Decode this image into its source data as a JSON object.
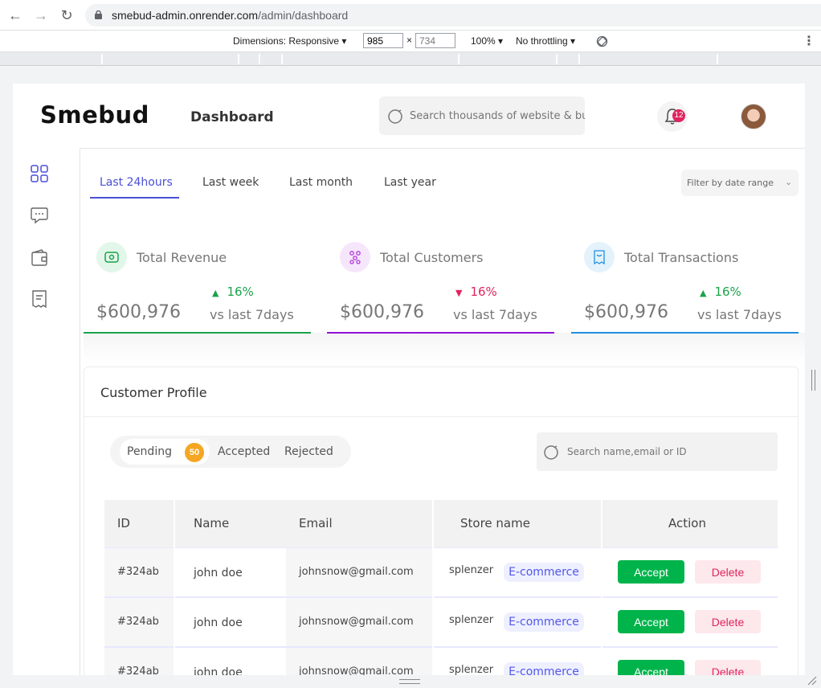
{
  "browser": {
    "url_host": "smebud-admin.onrender.com",
    "url_path": "/admin/dashboard",
    "device_dimensions": "Dimensions: Responsive",
    "width_value": "985",
    "height_value": "734",
    "zoom": "100%",
    "throttling": "No throttling"
  },
  "header": {
    "logo": "Smebud",
    "title": "Dashboard",
    "search_placeholder": "Search thousands of website & bussiness",
    "notification_count": "12"
  },
  "tabs": [
    {
      "label": "Last 24hours",
      "active": true
    },
    {
      "label": "Last week",
      "active": false
    },
    {
      "label": "Last month",
      "active": false
    },
    {
      "label": "Last year",
      "active": false
    }
  ],
  "filter": {
    "label": "Filter by date range"
  },
  "stats": [
    {
      "title": "Total Revenue",
      "trend": "16%",
      "direction": "up",
      "amount": "$600,976",
      "compare": "vs last 7days",
      "color": "#1aa34a"
    },
    {
      "title": "Total Customers",
      "trend": "16%",
      "direction": "down",
      "amount": "$600,976",
      "compare": "vs last 7days",
      "color": "#8e12d6"
    },
    {
      "title": "Total Transactions",
      "trend": "16%",
      "direction": "up",
      "amount": "$600,976",
      "compare": "vs last 7days",
      "color": "#1f8fe0"
    }
  ],
  "profile": {
    "title": "Customer Profile",
    "segments": {
      "pending": "Pending",
      "pending_count": "50",
      "accepted": "Accepted",
      "rejected": "Rejected"
    },
    "search_placeholder": "Search name,email or ID",
    "columns": [
      "ID",
      "Name",
      "Email",
      "Store name",
      "Action"
    ],
    "rows": [
      {
        "id": "#324ab",
        "name": "john doe",
        "email": "johnsnow@gmail.com",
        "store": "splenzer",
        "category": "E-commerce",
        "accept": "Accept",
        "delete": "Delete"
      },
      {
        "id": "#324ab",
        "name": "john doe",
        "email": "johnsnow@gmail.com",
        "store": "splenzer",
        "category": "E-commerce",
        "accept": "Accept",
        "delete": "Delete"
      },
      {
        "id": "#324ab",
        "name": "john doe",
        "email": "johnsnow@gmail.com",
        "store": "splenzer",
        "category": "E-commerce",
        "accept": "Accept",
        "delete": "Delete"
      }
    ]
  },
  "colors": {
    "accent": "#4b4fd8",
    "accept": "#00b44b",
    "delete": "#e0245e",
    "badge": "#f5a623"
  }
}
